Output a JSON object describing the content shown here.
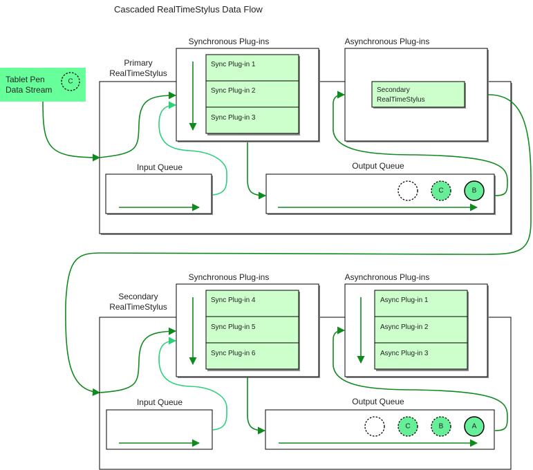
{
  "title": "Cascaded RealTimeStylus Data Flow",
  "tablet_stream": {
    "label_line1": "Tablet Pen",
    "label_line2": "Data Stream",
    "packet": "C"
  },
  "primary": {
    "name_line1": "Primary",
    "name_line2": "RealTimeStylus",
    "sync_header": "Synchronous Plug-ins",
    "async_header": "Asynchronous Plug-ins",
    "sync_plugins": [
      "Sync Plug-in 1",
      "Sync Plug-in 2",
      "Sync Plug-in 3"
    ],
    "async_item_line1": "Secondary",
    "async_item_line2": "RealTimeStylus",
    "input_queue": "Input Queue",
    "output_queue": "Output Queue",
    "output_packets": [
      "",
      "C",
      "B"
    ]
  },
  "secondary": {
    "name_line1": "Secondary",
    "name_line2": "RealTimeStylus",
    "sync_header": "Synchronous Plug-ins",
    "async_header": "Asynchronous Plug-ins",
    "sync_plugins": [
      "Sync Plug-in 4",
      "Sync Plug-in 5",
      "Sync Plug-in 6"
    ],
    "async_plugins": [
      "Async Plug-in 1",
      "Async Plug-in 2",
      "Async Plug-in 3"
    ],
    "input_queue": "Input Queue",
    "output_queue": "Output Queue",
    "output_packets": [
      "",
      "C",
      "B",
      "A"
    ]
  },
  "colors": {
    "plugin_fill": "#ccffcc",
    "stream_fill": "#66ff99",
    "packet_fill": "#66ee99",
    "flow_dark": "#0f8a1e",
    "flow_light": "#2bd07a"
  }
}
